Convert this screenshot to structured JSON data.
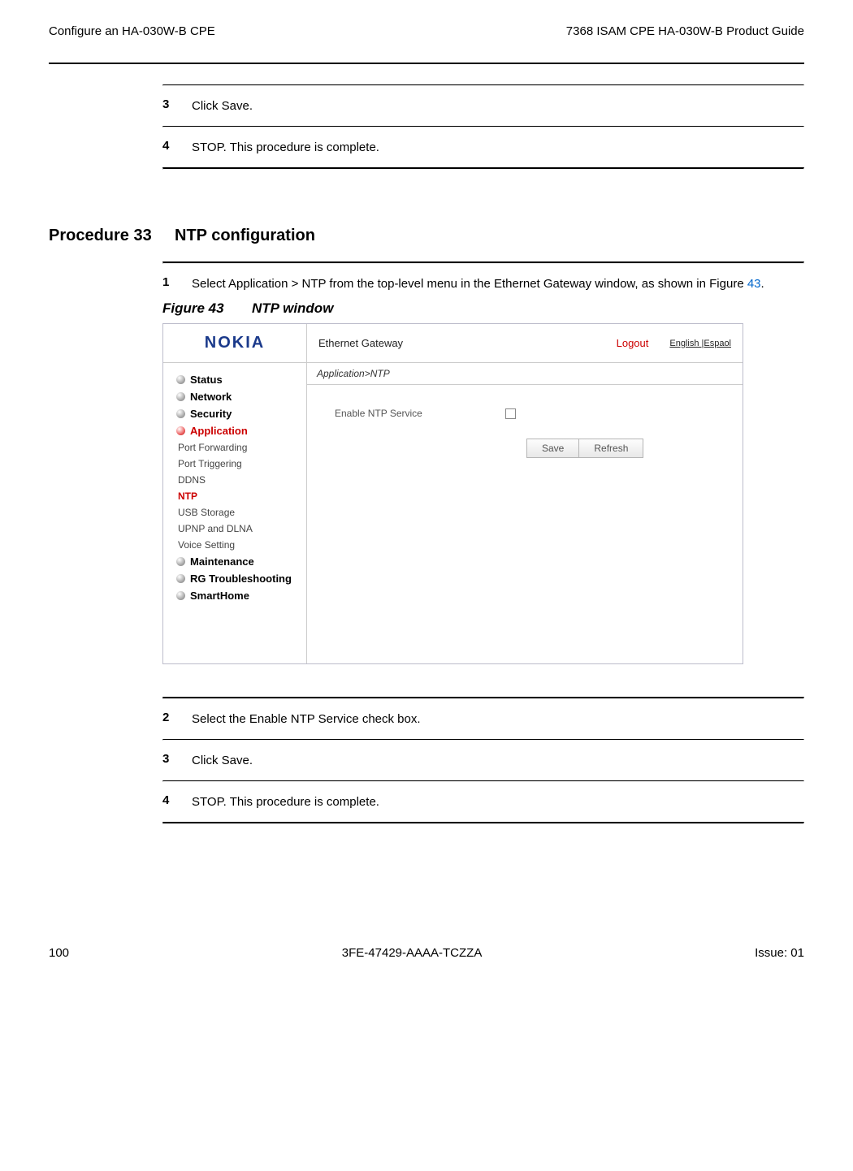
{
  "header": {
    "left": "Configure an HA-030W-B CPE",
    "right": "7368 ISAM CPE HA-030W-B Product Guide"
  },
  "stepsA": {
    "n3": "3",
    "t3": "Click Save.",
    "n4": "4",
    "t4": "STOP. This procedure is complete."
  },
  "procedure": {
    "label": "Procedure 33",
    "title": "NTP configuration"
  },
  "stepsB": {
    "n1": "1",
    "t1a": "Select Application > NTP from the top-level menu in the Ethernet Gateway window, as shown in Figure ",
    "t1link": "43",
    "t1b": "."
  },
  "figure": {
    "label": "Figure 43",
    "title": "NTP window"
  },
  "screenshot": {
    "logo": "NOKIA",
    "gateway": "Ethernet Gateway",
    "logout": "Logout",
    "lang": "English |Espaol",
    "breadcrumb": "Application>NTP",
    "label_enable": "Enable NTP Service",
    "btn_save": "Save",
    "btn_refresh": "Refresh",
    "nav": {
      "status": "Status",
      "network": "Network",
      "security": "Security",
      "application": "Application",
      "port_forwarding": "Port Forwarding",
      "port_triggering": "Port Triggering",
      "ddns": "DDNS",
      "ntp": "NTP",
      "usb": "USB Storage",
      "upnp": "UPNP and DLNA",
      "voice": "Voice Setting",
      "maintenance": "Maintenance",
      "rg": "RG Troubleshooting",
      "smarthome": "SmartHome"
    }
  },
  "stepsC": {
    "n2": "2",
    "t2": "Select the Enable NTP Service check box.",
    "n3": "3",
    "t3": "Click Save.",
    "n4": "4",
    "t4": "STOP. This procedure is complete."
  },
  "footer": {
    "left": "100",
    "center": "3FE-47429-AAAA-TCZZA",
    "right": "Issue: 01"
  }
}
